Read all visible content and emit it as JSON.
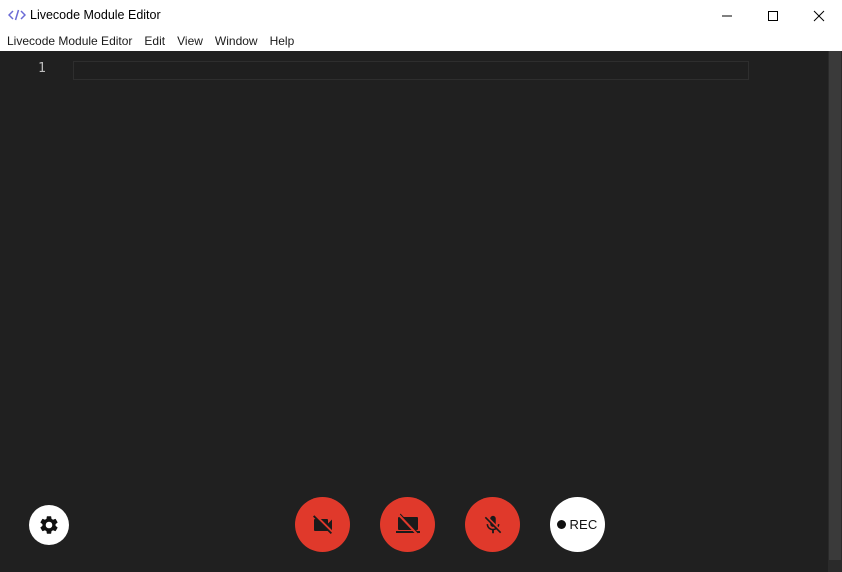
{
  "window": {
    "title": "Livecode Module Editor",
    "app_icon": "code-brackets-icon",
    "controls": [
      "minimize-icon",
      "maximize-icon",
      "close-icon"
    ]
  },
  "menubar": {
    "items": [
      {
        "label": "Livecode Module Editor"
      },
      {
        "label": "Edit"
      },
      {
        "label": "View"
      },
      {
        "label": "Window"
      },
      {
        "label": "Help"
      }
    ]
  },
  "editor": {
    "line_numbers": [
      "1"
    ],
    "content": "",
    "background": "#202020"
  },
  "toolbar": {
    "settings_icon": "gear-icon",
    "camera_icon": "camera-off-icon",
    "screen_icon": "screen-share-off-icon",
    "mic_icon": "mic-off-icon",
    "rec_label": "REC",
    "button_color": "#e0392b"
  }
}
